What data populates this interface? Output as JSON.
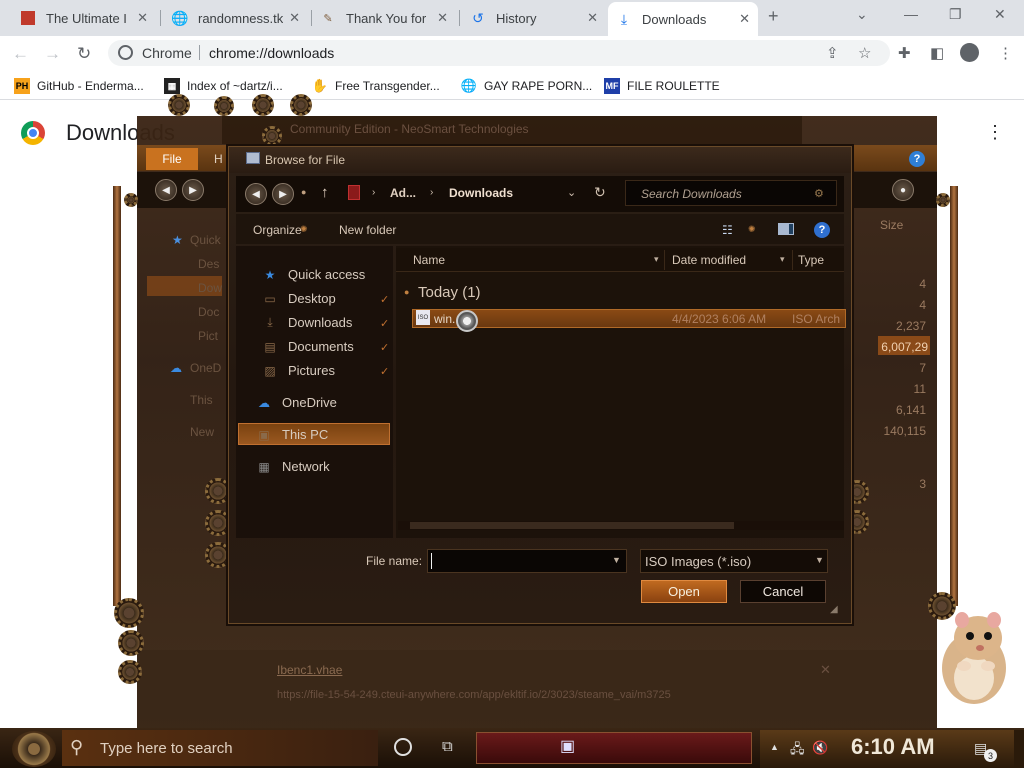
{
  "browser": {
    "tabs": [
      {
        "title": "The Ultimate I",
        "icon": "red-square-icon"
      },
      {
        "title": "randomness.tk",
        "icon": "globe-icon"
      },
      {
        "title": "Thank You for",
        "icon": "pen-icon"
      },
      {
        "title": "History",
        "icon": "history-icon"
      },
      {
        "title": "Downloads",
        "icon": "download-icon"
      }
    ],
    "new_tab": "+",
    "omnibox": {
      "label": "Chrome",
      "url": "chrome://downloads"
    },
    "bookmarks": [
      {
        "label": "GitHub - Enderma...",
        "icon": "PH"
      },
      {
        "label": "Index of ~dartz/i...",
        "icon": "dark-square"
      },
      {
        "label": "Free Transgender...",
        "icon": "hand"
      },
      {
        "label": "GAY RAPE PORN...",
        "icon": "globe"
      },
      {
        "label": "FILE ROULETTE",
        "icon": "MF"
      }
    ]
  },
  "downloads_page": {
    "heading": "Downloads"
  },
  "background_explorer": {
    "title": "Community Edition - NeoSmart Technologies",
    "file_tab": "File",
    "ribbon_tab": "H",
    "nav": [
      "Quick",
      "Des",
      "Dow",
      "Doc",
      "Pict",
      "OneD",
      "This",
      "New"
    ],
    "size_header": "Size",
    "sizes": [
      "4",
      "4",
      "2,237",
      "6,007,29",
      "7",
      "11",
      "6,141",
      "140,115",
      "3"
    ],
    "link": "Ibenc1.vhae",
    "url": "https://file-15-54-249.cteui-anywhere.com/app/ekltif.io/2/3023/steame_vai/m3725"
  },
  "dialog": {
    "title": "Browse for File",
    "breadcrumb": [
      "Ad...",
      "Downloads"
    ],
    "search_placeholder": "Search Downloads",
    "organize": "Organize",
    "new_folder": "New folder",
    "help": "?",
    "nav_pane": [
      {
        "label": "Quick access",
        "icon": "star-icon"
      },
      {
        "label": "Desktop",
        "icon": "desktop-icon",
        "pinned": true
      },
      {
        "label": "Downloads",
        "icon": "download-icon",
        "pinned": true
      },
      {
        "label": "Documents",
        "icon": "document-icon",
        "pinned": true
      },
      {
        "label": "Pictures",
        "icon": "picture-icon",
        "pinned": true
      },
      {
        "label": "OneDrive",
        "icon": "cloud-icon"
      },
      {
        "label": "This PC",
        "icon": "computer-icon"
      },
      {
        "label": "Network",
        "icon": "network-icon"
      }
    ],
    "columns": [
      "Name",
      "Date modified",
      "Type"
    ],
    "group": "Today (1)",
    "file": {
      "name": "win...p",
      "date": "4/4/2023 6:06 AM",
      "type": "ISO Arch"
    },
    "file_name_label": "File name:",
    "file_name_value": "",
    "file_type": "ISO Images (*.iso)",
    "open": "Open",
    "cancel": "Cancel"
  },
  "taskbar": {
    "search_placeholder": "Type here to search",
    "clock": "6:10 AM",
    "notification_count": "3"
  }
}
